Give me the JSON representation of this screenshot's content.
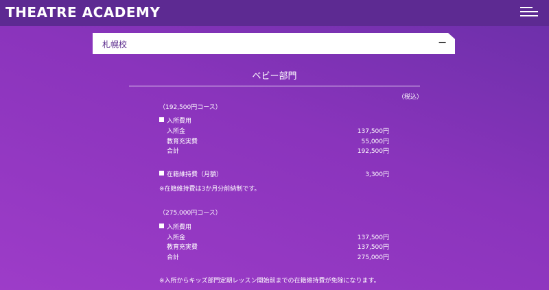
{
  "header": {
    "logo": "THEATRE ACADEMY"
  },
  "accordion": {
    "title": "札幌校",
    "toggle": "−"
  },
  "section": {
    "title": "ベビー部門",
    "tax_note": "（税込）"
  },
  "course1": {
    "title": "（192,500円コース）",
    "group1_label": "入所費用",
    "rows": [
      {
        "label": "入所金",
        "amount": "137,500円"
      },
      {
        "label": "教育充実費",
        "amount": "55,000円"
      },
      {
        "label": "合計",
        "amount": "192,500円"
      }
    ],
    "maintenance": {
      "label": "在籍維持費（月額）",
      "amount": "3,300円"
    },
    "note": "※在籍維持費は3か月分前納制です。"
  },
  "course2": {
    "title": "（275,000円コース）",
    "group1_label": "入所費用",
    "rows": [
      {
        "label": "入所金",
        "amount": "137,500円"
      },
      {
        "label": "教育充実費",
        "amount": "137,500円"
      },
      {
        "label": "合計",
        "amount": "275,000円"
      }
    ],
    "note": "※入所からキッズ部門定期レッスン開始前までの在籍維持費が免除になります。"
  }
}
